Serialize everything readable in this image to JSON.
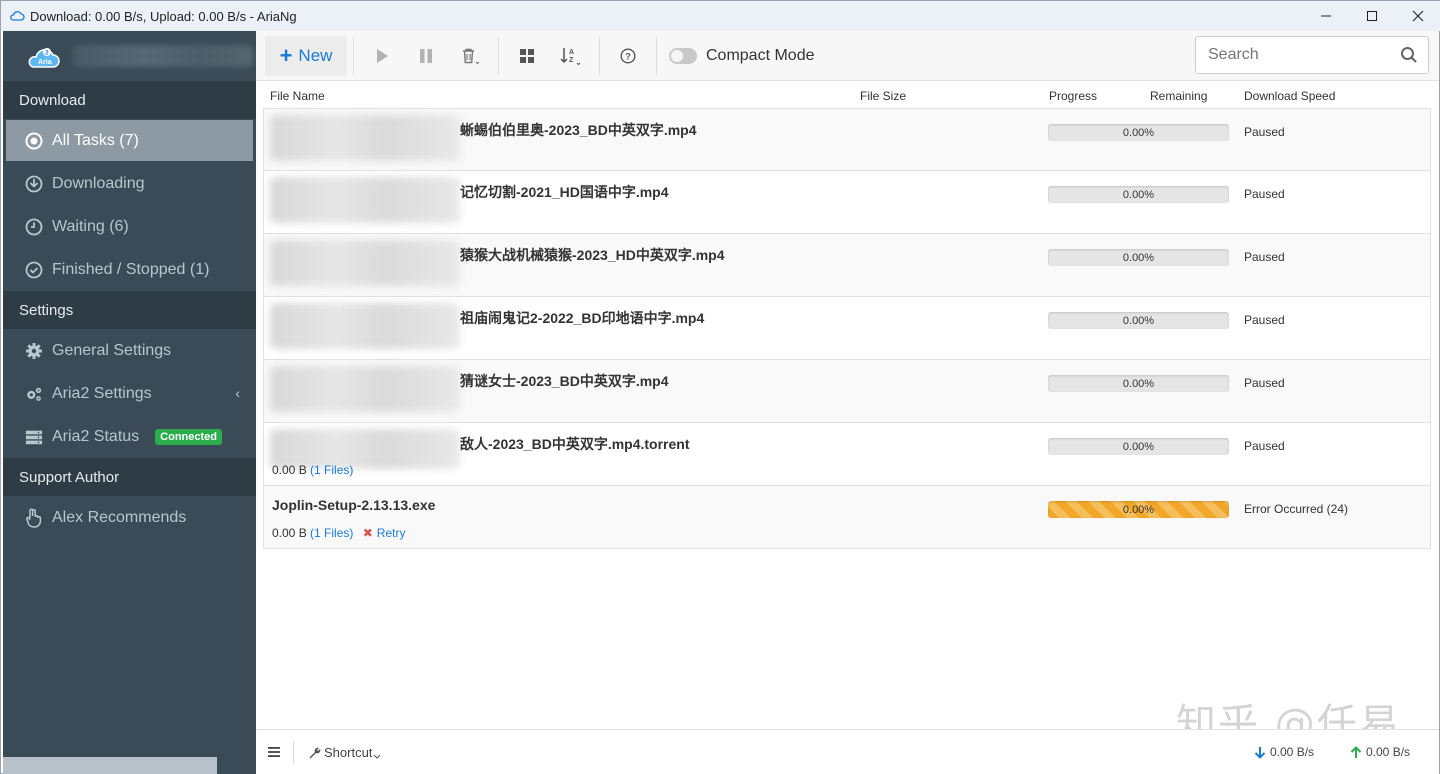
{
  "window": {
    "title": "Download: 0.00 B/s, Upload: 0.00 B/s - AriaNg"
  },
  "sidebar": {
    "sections": [
      {
        "header": "Download"
      },
      {
        "header": "Settings"
      },
      {
        "header": "Support Author"
      }
    ],
    "items": [
      {
        "label": "All Tasks (7)"
      },
      {
        "label": "Downloading"
      },
      {
        "label": "Waiting (6)"
      },
      {
        "label": "Finished / Stopped (1)"
      },
      {
        "label": "General Settings"
      },
      {
        "label": "Aria2 Settings"
      },
      {
        "label": "Aria2 Status",
        "badge": "Connected"
      },
      {
        "label": "Alex Recommends"
      }
    ],
    "logo_text": "Aria 2"
  },
  "toolbar": {
    "new_label": "New",
    "compact_mode_label": "Compact Mode",
    "search_placeholder": "Search"
  },
  "columns": {
    "file_name": "File Name",
    "file_size": "File Size",
    "progress": "Progress",
    "remaining": "Remaining",
    "download_speed": "Download Speed"
  },
  "tasks": [
    {
      "name": "蜥蜴伯伯里奥-2023_BD中英双字.mp4",
      "progress": "0.00%",
      "status": "Paused"
    },
    {
      "name": "记忆切割-2021_HD国语中字.mp4",
      "progress": "0.00%",
      "status": "Paused"
    },
    {
      "name": "猿猴大战机械猿猴-2023_HD中英双字.mp4",
      "progress": "0.00%",
      "status": "Paused"
    },
    {
      "name": "祖庙闹鬼记2-2022_BD印地语中字.mp4",
      "progress": "0.00%",
      "status": "Paused"
    },
    {
      "name": "猜谜女士-2023_BD中英双字.mp4",
      "progress": "0.00%",
      "status": "Paused"
    },
    {
      "name": "敌人-2023_BD中英双字.mp4.torrent",
      "progress": "0.00%",
      "status": "Paused",
      "size": "0.00 B",
      "files": "(1 Files)"
    },
    {
      "name": "Joplin-Setup-2.13.13.exe",
      "progress": "0.00%",
      "status": "Error Occurred (24)",
      "size": "0.00 B",
      "files": "(1 Files)",
      "retry": "Retry"
    }
  ],
  "statusbar": {
    "shortcut_label": "Shortcut",
    "download_speed": "0.00 B/s",
    "upload_speed": "0.00 B/s"
  },
  "watermark": "知乎 @任易",
  "colors": {
    "sidebar_bg": "#3a4b57",
    "accent": "#1a7bd6",
    "connected": "#2bad4d",
    "error_progress": "#f0a72a"
  }
}
